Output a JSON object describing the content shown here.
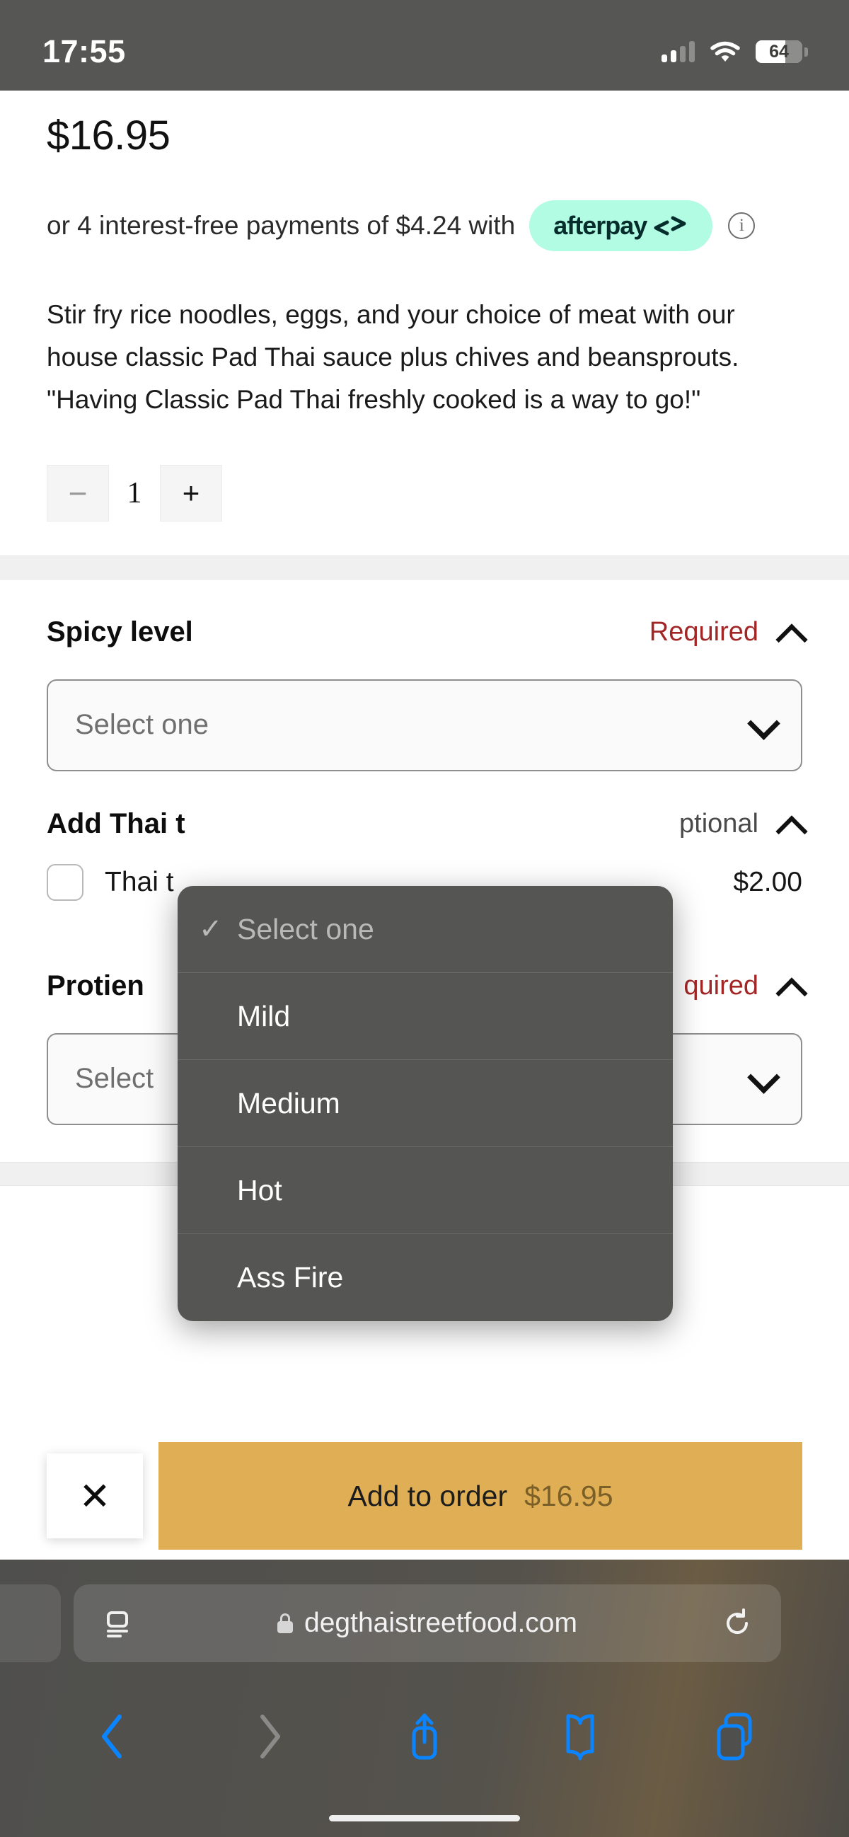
{
  "statusbar": {
    "time": "17:55",
    "battery_level": "64",
    "signal_icon": "cellular-signal-icon",
    "wifi_icon": "wifi-icon",
    "battery_icon": "battery-icon"
  },
  "product": {
    "price": "$16.95",
    "afterpay": {
      "prefix": "or 4 interest-free payments of $4.24 with",
      "brand": "afterpay",
      "badge_color": "#b2fce4",
      "info_icon": "info-circle-icon"
    },
    "description": "Stir fry rice noodles, eggs, and your choice of meat with our house classic Pad Thai sauce plus chives and beansprouts. \"Having Classic Pad Thai freshly cooked is a way to go!\"",
    "quantity": {
      "decrement": "−",
      "value": "1",
      "increment": "+"
    }
  },
  "options": [
    {
      "title": "Spicy level",
      "requirement": "Required",
      "requirement_color": "#a32626",
      "collapse_icon": "chevron-up-icon",
      "select_placeholder": "Select one",
      "dropdown_icon": "chevron-down-icon"
    },
    {
      "title": "Add Thai t",
      "requirement": "ptional",
      "requirement_color": "#4a4a4a",
      "collapse_icon": "chevron-up-icon",
      "checkbox_label": "Thai t",
      "checkbox_price": "$2.00"
    },
    {
      "title": "Protien",
      "requirement": "quired",
      "requirement_color": "#a32626",
      "collapse_icon": "chevron-up-icon",
      "select_placeholder": "Select",
      "dropdown_icon": "chevron-down-icon"
    }
  ],
  "dropdown_popup": {
    "items": [
      {
        "label": "Select one",
        "selected": true,
        "check_icon": "checkmark-icon"
      },
      {
        "label": "Mild",
        "selected": false,
        "check_icon": ""
      },
      {
        "label": "Medium",
        "selected": false,
        "check_icon": ""
      },
      {
        "label": "Hot",
        "selected": false,
        "check_icon": ""
      },
      {
        "label": "Ass Fire",
        "selected": false,
        "check_icon": ""
      }
    ]
  },
  "actionbar": {
    "close_icon": "close-x-icon",
    "add_label": "Add to order",
    "add_price": "$16.95",
    "add_button_color": "#dfae55"
  },
  "browser": {
    "url": "degthaistreetfood.com",
    "lock_icon": "lock-icon",
    "page_settings_icon": "page-settings-icon",
    "reload_icon": "reload-icon",
    "toolbar": [
      {
        "name": "back-icon",
        "enabled": true
      },
      {
        "name": "forward-icon",
        "enabled": false
      },
      {
        "name": "share-icon",
        "enabled": true
      },
      {
        "name": "bookmarks-icon",
        "enabled": true
      },
      {
        "name": "tabs-icon",
        "enabled": true
      }
    ]
  }
}
